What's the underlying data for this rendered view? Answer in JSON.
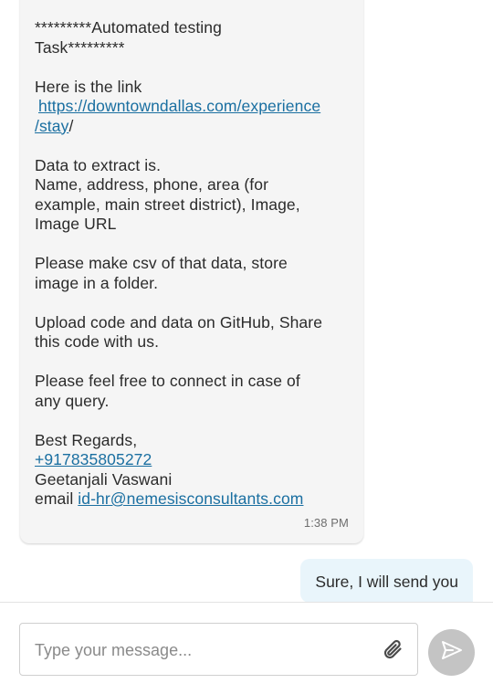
{
  "incoming_message": {
    "header_line1": "*********Automated testing",
    "header_line2": "Task*********",
    "link_intro": "Here is the link",
    "link_line1": "https://downtowndallas.com/experience",
    "link_line2": "/stay",
    "link_suffix": "/",
    "data_line1": "Data to extract is.",
    "data_line2": "Name, address, phone, area (for",
    "data_line3": "example, main street district), Image,",
    "data_line4": "Image URL",
    "csv_line1": "Please make csv of that data, store",
    "csv_line2": "image in a folder.",
    "upload_line1": "Upload code and data on GitHub, Share",
    "upload_line2": "this code with us.",
    "connect_line1": "Please feel free to connect in case of",
    "connect_line2": "any query.",
    "regards": "Best Regards,",
    "phone": "+917835805272",
    "name": "Geetanjali Vaswani",
    "email_label": "email ",
    "email": "id-hr@nemesisconsultants.com",
    "time": "1:38 PM"
  },
  "outgoing_message": {
    "text": "Sure, I will send you"
  },
  "composer": {
    "placeholder": "Type your message...",
    "attach_icon": "paperclip-icon",
    "send_icon": "send-icon"
  },
  "colors": {
    "incoming_bg": "#f5f5f5",
    "outgoing_bg": "#e9f5fb",
    "link": "#1a6fa1",
    "send_button": "#c4c4c4"
  }
}
